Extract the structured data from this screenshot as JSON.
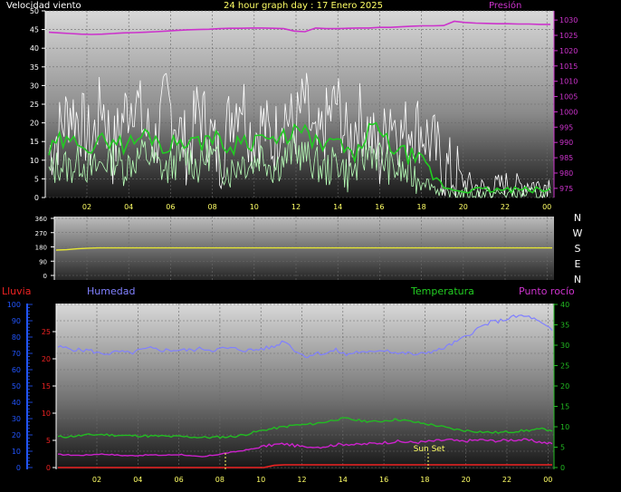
{
  "header": {
    "wind_label": "Velocidad viento",
    "title": "24 hour graph day : 17 Enero 2025",
    "pressure_label": "Presión"
  },
  "bottom_header": {
    "rain_label": "Lluvia",
    "humidity_label": "Humedad",
    "temperature_label": "Temperatura",
    "dew_label": "Punto rocío"
  },
  "compass": [
    "N",
    "W",
    "S",
    "E",
    "N"
  ],
  "annotation": {
    "sunset_label": "Sun Set"
  },
  "colors": {
    "wind_gust": "#ffffff",
    "wind_avg": "#22cc22",
    "wind_speed": "#b8ffb8",
    "pressure": "#cc33cc",
    "direction": "#e6e633",
    "humidity": "#8080ff",
    "temperature": "#22bb22",
    "dew": "#cc22cc",
    "rain": "#ee2222",
    "rain_axis": "#2255ff",
    "x_ticks": "#ffff66"
  },
  "chart_data": [
    {
      "name": "wind_pressure",
      "type": "line",
      "x_ticks": [
        "02",
        "04",
        "06",
        "08",
        "10",
        "12",
        "14",
        "16",
        "18",
        "20",
        "22",
        "00"
      ],
      "y_left_ticks": [
        0,
        5,
        10,
        15,
        20,
        25,
        30,
        35,
        40,
        45,
        50
      ],
      "ylim_left": [
        0,
        50
      ],
      "y_right_ticks": [
        975,
        980,
        985,
        990,
        995,
        1000,
        1005,
        1010,
        1015,
        1020,
        1025,
        1030
      ],
      "ylim_right": [
        972,
        1033
      ],
      "series": [
        {
          "key": "gust",
          "axis": "left",
          "values": [
            12,
            18,
            24,
            20,
            14,
            26,
            12,
            22,
            28,
            18,
            15,
            26,
            20,
            12,
            24,
            18,
            10,
            22,
            28,
            16,
            20,
            14,
            24,
            18,
            26,
            12,
            20,
            26,
            14,
            22,
            18,
            10,
            24,
            16,
            20,
            18,
            14,
            8,
            6,
            4,
            3,
            2,
            3,
            4,
            3,
            4,
            3,
            4
          ]
        },
        {
          "key": "avg",
          "axis": "left",
          "values": [
            12,
            15,
            14,
            16,
            13,
            15,
            16,
            14,
            15,
            17,
            16,
            13,
            15,
            16,
            14,
            17,
            15,
            13,
            16,
            15,
            17,
            14,
            16,
            18,
            17,
            15,
            13,
            16,
            11,
            12,
            19,
            17,
            14,
            12,
            11,
            9,
            6,
            3,
            2,
            2,
            2,
            2,
            2,
            2,
            2,
            2,
            2,
            2
          ]
        },
        {
          "key": "speed",
          "axis": "left",
          "values": [
            6,
            9,
            8,
            10,
            7,
            9,
            11,
            8,
            10,
            12,
            9,
            7,
            10,
            11,
            8,
            12,
            9,
            7,
            10,
            9,
            12,
            8,
            10,
            13,
            11,
            9,
            7,
            10,
            6,
            8,
            13,
            11,
            8,
            7,
            6,
            5,
            3,
            1,
            1,
            1,
            1,
            1,
            1,
            1,
            1,
            1,
            1,
            1
          ]
        },
        {
          "key": "pressure",
          "axis": "right",
          "values": [
            1026,
            1025.8,
            1025.6,
            1025.4,
            1025.3,
            1025.4,
            1025.6,
            1025.8,
            1025.9,
            1026,
            1026.2,
            1026.4,
            1026.6,
            1026.8,
            1026.9,
            1027,
            1027.2,
            1027.3,
            1027.3,
            1027.4,
            1027.4,
            1027.3,
            1027.2,
            1026.4,
            1026.2,
            1027.4,
            1027.2,
            1027.2,
            1027.3,
            1027.4,
            1027.4,
            1027.6,
            1027.6,
            1027.8,
            1028,
            1028.1,
            1028.1,
            1028.2,
            1029.6,
            1029.2,
            1029,
            1028.9,
            1028.8,
            1028.8,
            1028.7,
            1028.7,
            1028.6,
            1028.6
          ]
        }
      ]
    },
    {
      "name": "wind_direction",
      "type": "line",
      "y_ticks": [
        0,
        90,
        180,
        270,
        360
      ],
      "ylim": [
        0,
        360
      ],
      "series": [
        {
          "key": "direction",
          "values": [
            160,
            162,
            168,
            172,
            174,
            174,
            174,
            174,
            174,
            174,
            174,
            174,
            174,
            174,
            174,
            174,
            174,
            174,
            174,
            174,
            174,
            174,
            174,
            174,
            174,
            174,
            174,
            174,
            174,
            174,
            174,
            174,
            174,
            174,
            174,
            174,
            174,
            174,
            174,
            174,
            174,
            174,
            174,
            174,
            174,
            174,
            174,
            174
          ]
        }
      ]
    },
    {
      "name": "humidity_temperature",
      "type": "line",
      "x_ticks": [
        "02",
        "04",
        "06",
        "08",
        "10",
        "12",
        "14",
        "16",
        "18",
        "20",
        "22",
        "00"
      ],
      "y_humidity_ticks": [
        0,
        10,
        20,
        30,
        40,
        50,
        60,
        70,
        80,
        90,
        100
      ],
      "ylim_humidity": [
        0,
        100
      ],
      "y_rain_ticks": [
        0,
        5,
        10,
        15,
        20,
        25
      ],
      "ylim_rain": [
        0,
        30
      ],
      "y_temp_ticks": [
        0,
        5,
        10,
        15,
        20,
        25,
        30,
        35,
        40
      ],
      "ylim_temp": [
        0,
        40
      ],
      "series": [
        {
          "key": "humidity",
          "axis": "humidity",
          "values": [
            74,
            73,
            72,
            72,
            70,
            70,
            71,
            70,
            72,
            73,
            72,
            72,
            72,
            72,
            73,
            72,
            73,
            73,
            72,
            72,
            73,
            74,
            78,
            72,
            68,
            70,
            70,
            72,
            69,
            71,
            70,
            72,
            72,
            70,
            70,
            69,
            71,
            72,
            75,
            78,
            82,
            86,
            89,
            90,
            92,
            93,
            92,
            88,
            84
          ]
        },
        {
          "key": "temperature",
          "axis": "temp",
          "values": [
            7.5,
            7.6,
            7.8,
            8,
            8.1,
            8,
            7.9,
            7.8,
            7.8,
            7.7,
            7.7,
            7.6,
            7.6,
            7.5,
            7.4,
            7.4,
            7.5,
            7.6,
            8,
            8.6,
            9.2,
            9.6,
            10,
            10.4,
            10.5,
            10.8,
            11.2,
            11.8,
            12,
            11.6,
            11.4,
            11.2,
            11.6,
            11.8,
            11.4,
            11,
            10.6,
            10.2,
            9.6,
            9.2,
            9,
            8.8,
            8.6,
            8.6,
            8.8,
            9,
            9.2,
            9.4,
            9.2
          ]
        },
        {
          "key": "dew",
          "axis": "temp",
          "values": [
            3.2,
            3.1,
            3,
            3.1,
            3.3,
            3.2,
            3,
            2.9,
            3,
            3.1,
            3,
            3.1,
            3.2,
            2.8,
            2.6,
            3,
            3.4,
            3.8,
            4.2,
            4.6,
            5.2,
            5.6,
            5.8,
            5.4,
            5,
            5,
            5.2,
            5.6,
            5.8,
            5.6,
            5.8,
            6,
            6.2,
            6.4,
            6.2,
            6.2,
            6.4,
            6.6,
            6.8,
            6.4,
            6.6,
            6.8,
            6.6,
            6.6,
            6.8,
            6.8,
            6.6,
            6.2,
            5.8
          ]
        },
        {
          "key": "rain",
          "axis": "rain",
          "values": [
            0,
            0,
            0,
            0,
            0,
            0,
            0,
            0,
            0,
            0,
            0,
            0,
            0,
            0,
            0,
            0,
            0,
            0,
            0,
            0,
            0,
            0.4,
            0.5,
            0.5,
            0.5,
            0.5,
            0.5,
            0.5,
            0.5,
            0.5,
            0.5,
            0.5,
            0.5,
            0.5,
            0.5,
            0.5,
            0.5,
            0.5,
            0.5,
            0.5,
            0.5,
            0.5,
            0.5,
            0.5,
            0.5,
            0.5,
            0.5,
            0.5,
            0.5
          ]
        }
      ]
    }
  ]
}
